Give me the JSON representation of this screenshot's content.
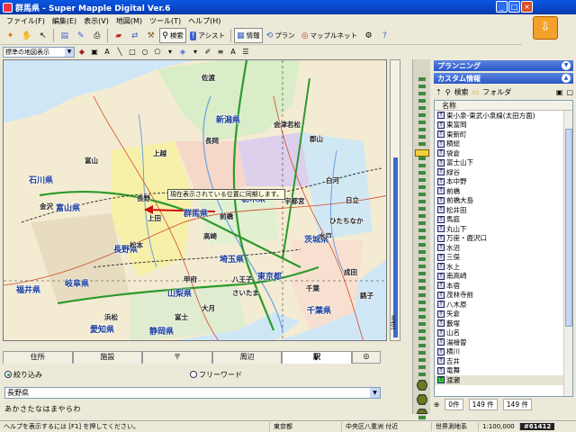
{
  "window": {
    "title": "群馬県 - Super Mapple Digital Ver.6",
    "controls": [
      "_",
      "□",
      "×"
    ]
  },
  "menu": [
    "ファイル(F)",
    "編集(E)",
    "表示(V)",
    "地図(M)",
    "ツール(T)",
    "ヘルプ(H)"
  ],
  "toolbar": {
    "search_label": "検索",
    "assist_label": "アシスト",
    "info_label": "情報",
    "plan_label": "プラン",
    "mapple_net_label": "マップルネット"
  },
  "toolbar2": {
    "map_style": "標準の地図表示"
  },
  "map": {
    "tooltip": "現在表示されている位置に同期します。",
    "prefectures": [
      "新潟県",
      "石川県",
      "福井県",
      "富山県",
      "長野県",
      "群馬県",
      "栃木県",
      "茨城県",
      "埼玉県",
      "東京都",
      "千葉県",
      "山梨県",
      "岐阜県",
      "愛知県",
      "静岡県"
    ],
    "cities": [
      "金沢",
      "富山",
      "長野",
      "前橋",
      "宇都宮",
      "水戸",
      "さいたま",
      "千葉",
      "甲府",
      "上田",
      "高崎",
      "ひたちなか",
      "会津若松",
      "郡山",
      "白河",
      "佐渡",
      "長岡",
      "上越",
      "松本",
      "大月",
      "成田",
      "富士",
      "銚子",
      "八王子",
      "浜松",
      "日立"
    ],
    "ruler_text": "10km"
  },
  "tabs": [
    "住所",
    "施設",
    "〒",
    "周辺",
    "駅"
  ],
  "active_tab": "駅",
  "search": {
    "radio1": "絞り込み",
    "radio2": "フリーワード",
    "prefecture": "長野県",
    "kana": "あかさたなはまやらわ"
  },
  "status": {
    "help": "ヘルプを表示するには [F1] を押してください。",
    "pref": "東京都",
    "address": "中央区八重洲 付近",
    "datum": "世界測地系",
    "scale": "1:100,000"
  },
  "panel": {
    "planning": "プランニング",
    "custom_info": "カスタム情報",
    "search": "検索",
    "folder": "フォルダ",
    "header": "名称",
    "items": [
      "東小泉-東武小泉線(太田方面)",
      "東富岡",
      "東新町",
      "積総",
      "袋倉",
      "富士山下",
      "緑谷",
      "本中野",
      "前橋",
      "前橋大島",
      "松井田",
      "馬庭",
      "丸山下",
      "万座・鹿沢口",
      "水沼",
      "三俣",
      "水上",
      "南高崎",
      "本宿",
      "茂林寺前",
      "八木原",
      "矢倉",
      "藪塚",
      "山名",
      "湯檜曽",
      "横川",
      "吉井",
      "竜舞",
      "渡瀬"
    ],
    "count1": "0件",
    "count2": "149 件",
    "count3": "149 件"
  },
  "watermark": "#61412"
}
